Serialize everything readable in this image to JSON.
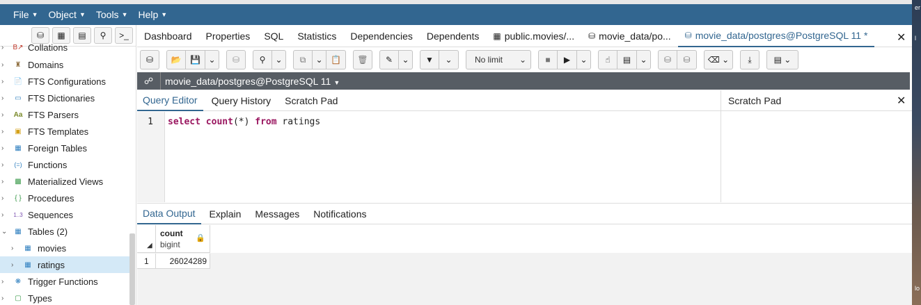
{
  "menu": {
    "items": [
      {
        "label": "File"
      },
      {
        "label": "Object"
      },
      {
        "label": "Tools"
      },
      {
        "label": "Help"
      }
    ]
  },
  "right_edge": {
    "text_top": "er",
    "text_mid": "l",
    "text_bottom": "lo"
  },
  "tree": {
    "items": [
      {
        "label": "Collations",
        "icon": "collation-icon"
      },
      {
        "label": "Domains",
        "icon": "domain-icon"
      },
      {
        "label": "FTS Configurations",
        "icon": "fts-config-icon"
      },
      {
        "label": "FTS Dictionaries",
        "icon": "fts-dictionary-icon"
      },
      {
        "label": "FTS Parsers",
        "icon": "fts-parser-icon",
        "glyph": "Aa"
      },
      {
        "label": "FTS Templates",
        "icon": "fts-template-icon"
      },
      {
        "label": "Foreign Tables",
        "icon": "foreign-table-icon"
      },
      {
        "label": "Functions",
        "icon": "function-icon",
        "glyph": "(=)"
      },
      {
        "label": "Materialized Views",
        "icon": "materialized-view-icon"
      },
      {
        "label": "Procedures",
        "icon": "procedure-icon",
        "glyph": "{ }"
      },
      {
        "label": "Sequences",
        "icon": "sequence-icon",
        "glyph": "1..3"
      },
      {
        "label": "Tables (2)",
        "icon": "tables-icon"
      },
      {
        "label": "movies",
        "icon": "table-icon"
      },
      {
        "label": "ratings",
        "icon": "table-icon"
      },
      {
        "label": "Trigger Functions",
        "icon": "trigger-function-icon"
      },
      {
        "label": "Types",
        "icon": "type-icon"
      }
    ]
  },
  "tabs": {
    "items": [
      {
        "label": "Dashboard"
      },
      {
        "label": "Properties"
      },
      {
        "label": "SQL"
      },
      {
        "label": "Statistics"
      },
      {
        "label": "Dependencies"
      },
      {
        "label": "Dependents"
      },
      {
        "label": "public.movies/..."
      },
      {
        "label": "movie_data/po..."
      },
      {
        "label": "movie_data/postgres@PostgreSQL 11 *"
      }
    ]
  },
  "toolbar": {
    "limit_label": "No limit"
  },
  "connection": {
    "label": "movie_data/postgres@PostgreSQL 11"
  },
  "editor": {
    "tabs": [
      {
        "label": "Query Editor"
      },
      {
        "label": "Query History"
      },
      {
        "label": "Scratch Pad"
      }
    ],
    "scratch_title": "Scratch Pad",
    "line_number": "1",
    "code": {
      "kw1": "select",
      "kw2": "count",
      "p1": "(*)",
      "kw3": "from",
      "p2": "ratings"
    }
  },
  "output": {
    "tabs": [
      {
        "label": "Data Output"
      },
      {
        "label": "Explain"
      },
      {
        "label": "Messages"
      },
      {
        "label": "Notifications"
      }
    ],
    "column": {
      "name": "count",
      "type": "bigint"
    },
    "rows": [
      {
        "num": "1",
        "value": "26024289"
      }
    ]
  },
  "colors": {
    "menubar": "#326690",
    "accent": "#326690",
    "keyword": "#9a1760",
    "connbar": "#575d64"
  }
}
